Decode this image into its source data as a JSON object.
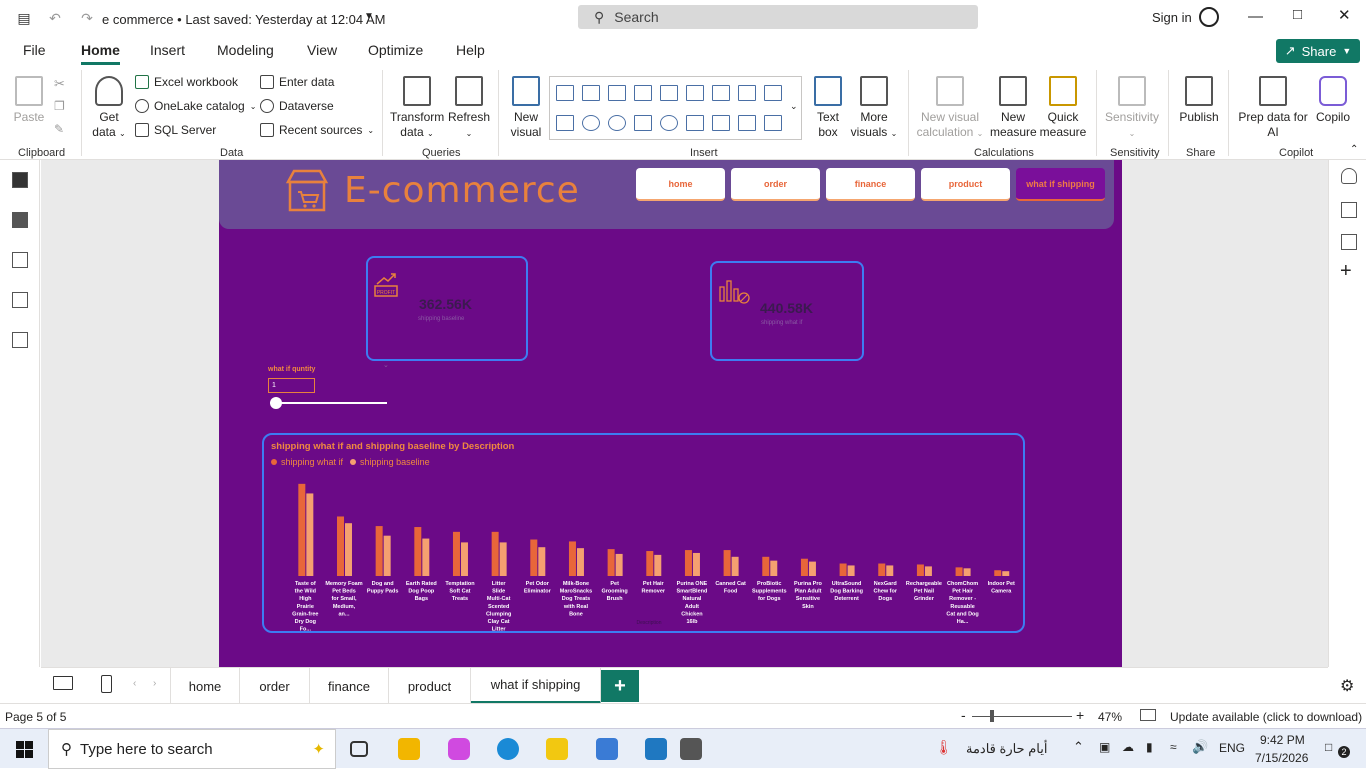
{
  "window": {
    "title": "e commerce",
    "saved_status": "• Last saved: Yesterday at 12:04 AM",
    "search_placeholder": "Search",
    "sign_in": "Sign in"
  },
  "menu": {
    "items": [
      "File",
      "Home",
      "Insert",
      "Modeling",
      "View",
      "Optimize",
      "Help"
    ],
    "active": "Home",
    "share_label": "Share"
  },
  "ribbon": {
    "clipboard": {
      "paste": "Paste",
      "group": "Clipboard"
    },
    "data": {
      "get_data": "Get",
      "get_data2": "data",
      "excel": "Excel workbook",
      "onelake": "OneLake catalog",
      "sql": "SQL Server",
      "enter_data": "Enter data",
      "dataverse": "Dataverse",
      "recent": "Recent sources",
      "group": "Data"
    },
    "queries": {
      "transform": "Transform",
      "transform2": "data",
      "refresh": "Refresh",
      "group": "Queries"
    },
    "insert": {
      "new_visual": "New",
      "new_visual2": "visual",
      "text_box": "Text",
      "text_box2": "box",
      "more_visuals": "More",
      "more_visuals2": "visuals",
      "group": "Insert"
    },
    "calculations": {
      "new_visual_calc": "New visual",
      "new_visual_calc2": "calculation",
      "new_measure": "New",
      "new_measure2": "measure",
      "quick_measure": "Quick",
      "quick_measure2": "measure",
      "group": "Calculations"
    },
    "sensitivity": {
      "label": "Sensitivity",
      "group": "Sensitivity"
    },
    "share": {
      "publish": "Publish",
      "group": "Share"
    },
    "copilot": {
      "prep": "Prep data for",
      "prep2": "AI",
      "copilot": "Copilo",
      "group": "Copilot"
    }
  },
  "report": {
    "logo_text": "E-commerce",
    "nav": [
      "home",
      "order",
      "finance",
      "product",
      "what if shipping"
    ],
    "active_nav": "what if shipping",
    "card1": {
      "value": "362.56K",
      "label": "shipping baseline",
      "icon_text": "PROFIT"
    },
    "card2": {
      "value": "440.58K",
      "label": "shipping what if"
    },
    "slicer": {
      "title": "what if quntity",
      "value": "1",
      "level_fraction": 0
    }
  },
  "chart_data": {
    "type": "bar",
    "title": "shipping what if and shipping baseline by Description",
    "legend_position": "top-left",
    "xlabel": "Description",
    "colors": {
      "shipping what if": "#e8663a",
      "shipping baseline": "#f5a070"
    },
    "categories": [
      "Taste of the Wild High Prairie Grain-free Dry Dog Fo...",
      "Memory Foam Pet Beds for Small, Medium, an...",
      "Dog and Puppy Pads",
      "Earth Rated Dog Poop Bags",
      "Temptation Soft Cat Treats",
      "Litter Slide Multi-Cat Scented Clumping Clay Cat Litter",
      "Pet Odor Eliminator",
      "Milk-Bone MaroSnacks Dog Treats with Real Bone",
      "Pet Grooming Brush",
      "Pet Hair Remover",
      "Purina ONE SmartBlend Natural Adult Chicken 16lb",
      "Canned Cat Food",
      "ProBiotic Supplements for Dogs",
      "Purina Pro Plan Adult Sensitive Skin",
      "UltraSound Dog Barking Deterrent",
      "NexGard Chew for Dogs",
      "Rechargeable Pet Nail Grinder",
      "ChomChom Pet Hair Remover - Reusable Cat and Dog Ha...",
      "Indoor Pet Camera"
    ],
    "series": [
      {
        "name": "shipping what if",
        "values": [
          96,
          62,
          52,
          51,
          46,
          46,
          38,
          36,
          28,
          26,
          27,
          27,
          20,
          18,
          13,
          13,
          12,
          9,
          6
        ]
      },
      {
        "name": "shipping baseline",
        "values": [
          86,
          55,
          42,
          39,
          35,
          35,
          30,
          29,
          23,
          22,
          24,
          20,
          16,
          15,
          11,
          11,
          10,
          8,
          5
        ]
      }
    ]
  },
  "page_tabs": [
    "home",
    "order",
    "finance",
    "product",
    "what if shipping"
  ],
  "active_tab": "what if shipping",
  "status": {
    "page": "Page 5 of 5",
    "zoom": "47%",
    "zoom_level_fraction": 0.47,
    "update": "Update available (click to download)"
  },
  "taskbar": {
    "search_placeholder": "Type here to search",
    "weather": "أيام حارة قادمة",
    "lang": "ENG",
    "time": "9:42 PM",
    "date": "7/15/2026",
    "notifications": "2"
  }
}
